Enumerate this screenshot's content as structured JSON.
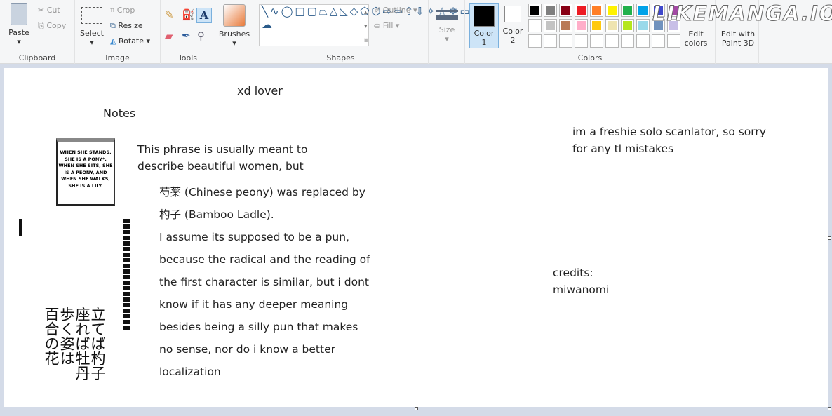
{
  "ribbon": {
    "clipboard": {
      "paste": "Paste",
      "cut": "Cut",
      "copy": "Copy",
      "label": "Clipboard"
    },
    "image": {
      "select": "Select",
      "crop": "Crop",
      "resize": "Resize",
      "rotate": "Rotate",
      "label": "Image"
    },
    "tools": {
      "label": "Tools"
    },
    "brushes": {
      "label": "Brushes"
    },
    "shapes": {
      "outline": "Outline",
      "fill": "Fill",
      "label": "Shapes",
      "glyphs": "╲∿◯□▢⏢△◺◇⬠⬡⇨⇦⇧⇩✧☆✡▭◯☁"
    },
    "size": {
      "label": "Size"
    },
    "colors": {
      "color1": "Color 1",
      "color2": "Color 2",
      "edit_colors": "Edit colors",
      "label": "Colors",
      "palette_row1": [
        "#000000",
        "#7f7f7f",
        "#880015",
        "#ed1c24",
        "#ff7f27",
        "#fff200",
        "#22b14c",
        "#00a2e8",
        "#3f48cc",
        "#a349a4"
      ],
      "palette_row2": [
        "#ffffff",
        "#c3c3c3",
        "#b97a57",
        "#ffaec9",
        "#ffc90e",
        "#efe4b0",
        "#b5e61d",
        "#99d9ea",
        "#7092be",
        "#c8bfe7"
      ],
      "color1_value": "#000000",
      "color2_value": "#ffffff"
    },
    "paint3d": "Edit with Paint 3D",
    "watermark": "LIKEMANGA.IO"
  },
  "canvas": {
    "title": "xd lover",
    "notes": "Notes",
    "manga_bubble": "WHEN SHE STANDS, SHE IS A PONY*, WHEN SHE SITS, SHE IS A PEONY, AND WHEN SHE WALKS, SHE IS A LILY.",
    "japanese": [
      "立てば杓子",
      "座れば牡丹",
      "歩く姿は",
      "百合の花"
    ],
    "intro": [
      "This phrase is usually meant to",
      "describe beautiful women, but"
    ],
    "body": [
      "芍薬 (Chinese peony) was replaced by",
      "杓子 (Bamboo Ladle).",
      "I assume its supposed to be a pun,",
      "because the radical and the reading of",
      "the first character is similar, but i dont",
      "know if it has any deeper meaning",
      "besides being a silly pun that makes",
      "no sense, nor do i know a better",
      "localization"
    ],
    "apology": [
      "im a freshie solo scanlator, so sorry",
      "for any tl mistakes"
    ],
    "credits": [
      "credits:",
      "miwanomi"
    ]
  }
}
